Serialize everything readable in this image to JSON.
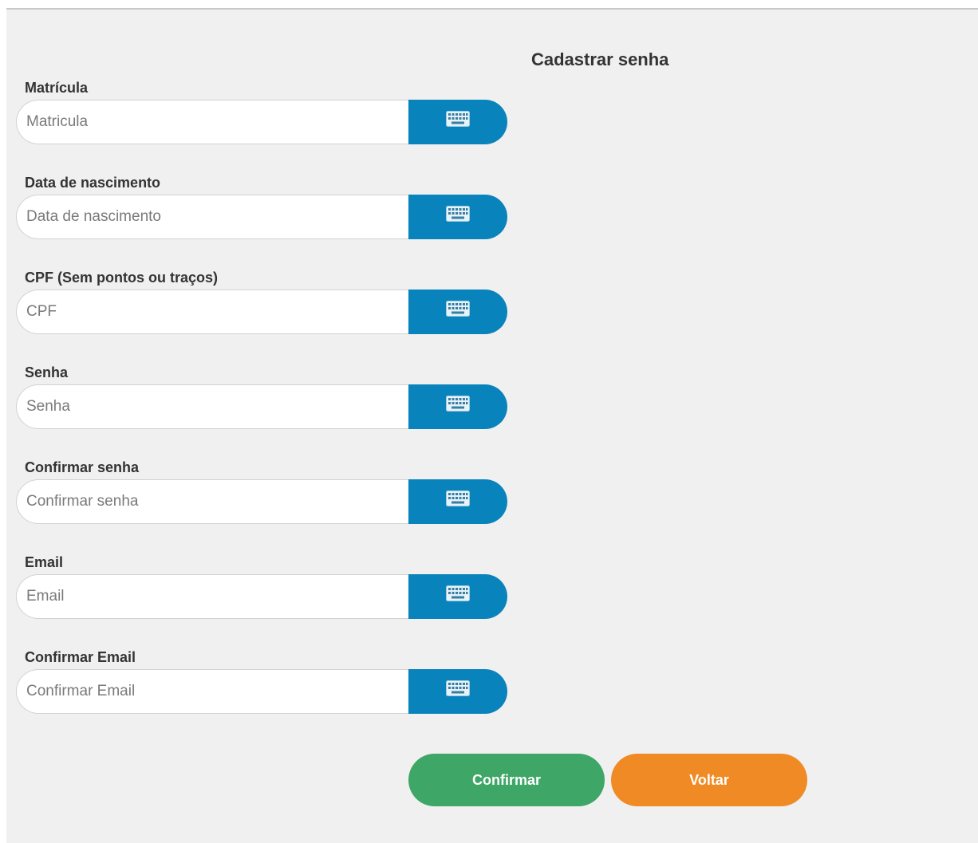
{
  "page": {
    "title": "Cadastrar senha"
  },
  "fields": [
    {
      "label": "Matrícula",
      "placeholder": "Matricula"
    },
    {
      "label": "Data de nascimento",
      "placeholder": "Data de nascimento"
    },
    {
      "label": "CPF (Sem pontos ou traços)",
      "placeholder": "CPF"
    },
    {
      "label": "Senha",
      "placeholder": "Senha"
    },
    {
      "label": "Confirmar senha",
      "placeholder": "Confirmar senha"
    },
    {
      "label": "Email",
      "placeholder": "Email"
    },
    {
      "label": "Confirmar Email",
      "placeholder": "Confirmar Email"
    }
  ],
  "keyboard_button": {
    "icon": "keyboard-icon"
  },
  "actions": {
    "confirm_label": "Confirmar",
    "back_label": "Voltar"
  },
  "colors": {
    "keyboard_button": "#0983bb",
    "confirm_button": "#3ea666",
    "back_button": "#f08a24",
    "background": "#f0f0f0"
  }
}
